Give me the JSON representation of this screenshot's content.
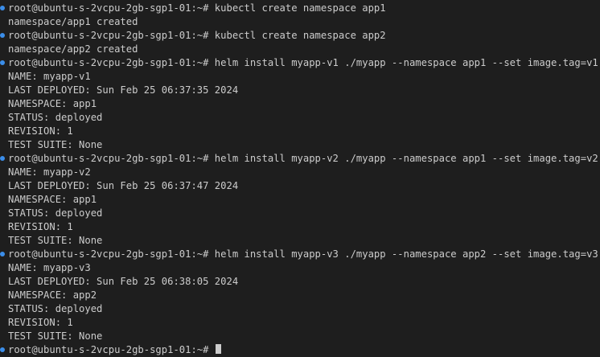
{
  "terminal": {
    "lines": [
      {
        "kind": "prompt",
        "text": "root@ubuntu-s-2vcpu-2gb-sgp1-01:~# kubectl create namespace app1"
      },
      {
        "kind": "output",
        "text": "namespace/app1 created"
      },
      {
        "kind": "prompt",
        "text": "root@ubuntu-s-2vcpu-2gb-sgp1-01:~# kubectl create namespace app2"
      },
      {
        "kind": "output",
        "text": "namespace/app2 created"
      },
      {
        "kind": "prompt",
        "text": "root@ubuntu-s-2vcpu-2gb-sgp1-01:~# helm install myapp-v1 ./myapp --namespace app1 --set image.tag=v1"
      },
      {
        "kind": "output",
        "text": "NAME: myapp-v1"
      },
      {
        "kind": "output",
        "text": "LAST DEPLOYED: Sun Feb 25 06:37:35 2024"
      },
      {
        "kind": "output",
        "text": "NAMESPACE: app1"
      },
      {
        "kind": "output",
        "text": "STATUS: deployed"
      },
      {
        "kind": "output",
        "text": "REVISION: 1"
      },
      {
        "kind": "output",
        "text": "TEST SUITE: None"
      },
      {
        "kind": "prompt",
        "text": "root@ubuntu-s-2vcpu-2gb-sgp1-01:~# helm install myapp-v2 ./myapp --namespace app1 --set image.tag=v2"
      },
      {
        "kind": "output",
        "text": "NAME: myapp-v2"
      },
      {
        "kind": "output",
        "text": "LAST DEPLOYED: Sun Feb 25 06:37:47 2024"
      },
      {
        "kind": "output",
        "text": "NAMESPACE: app1"
      },
      {
        "kind": "output",
        "text": "STATUS: deployed"
      },
      {
        "kind": "output",
        "text": "REVISION: 1"
      },
      {
        "kind": "output",
        "text": "TEST SUITE: None"
      },
      {
        "kind": "prompt",
        "text": "root@ubuntu-s-2vcpu-2gb-sgp1-01:~# helm install myapp-v3 ./myapp --namespace app2 --set image.tag=v3"
      },
      {
        "kind": "output",
        "text": "NAME: myapp-v3"
      },
      {
        "kind": "output",
        "text": "LAST DEPLOYED: Sun Feb 25 06:38:05 2024"
      },
      {
        "kind": "output",
        "text": "NAMESPACE: app2"
      },
      {
        "kind": "output",
        "text": "STATUS: deployed"
      },
      {
        "kind": "output",
        "text": "REVISION: 1"
      },
      {
        "kind": "output",
        "text": "TEST SUITE: None"
      },
      {
        "kind": "current",
        "text": "root@ubuntu-s-2vcpu-2gb-sgp1-01:~# "
      }
    ]
  },
  "colors": {
    "background": "#1e1e1e",
    "text": "#cccccc",
    "command_marker": "#3b8eea"
  }
}
